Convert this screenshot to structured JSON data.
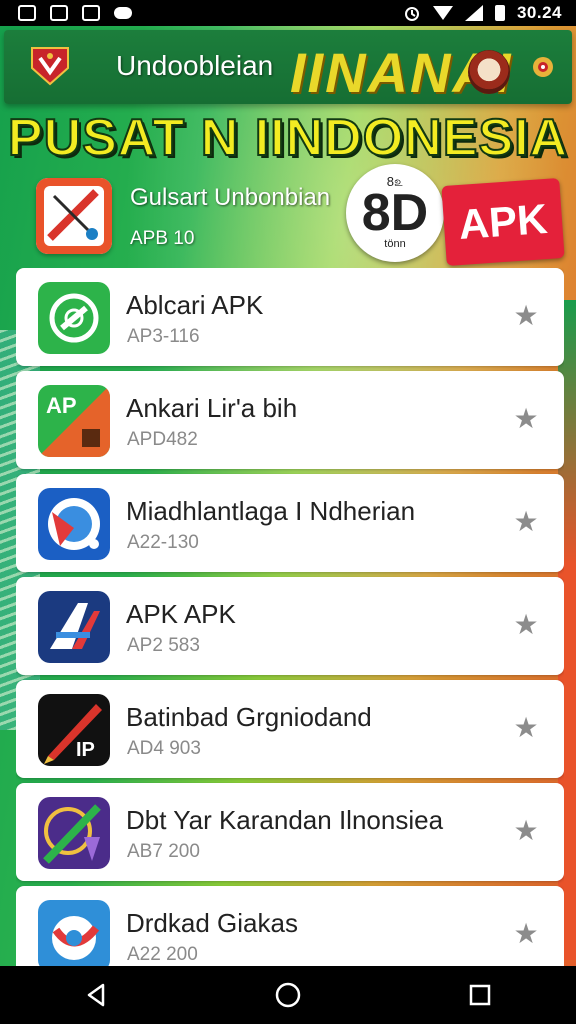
{
  "status_bar": {
    "time": "30.24",
    "left_icons": [
      "image-icon",
      "gallery-icon",
      "photo-icon",
      "cloud-icon"
    ],
    "right_icons": [
      "alarm-icon",
      "wifi-icon",
      "signal-icon",
      "battery-icon"
    ]
  },
  "header": {
    "title": "Undoobleian",
    "brand": "IINANAI",
    "icons": [
      "logo-icon",
      "mascot-icon",
      "gear-icon"
    ]
  },
  "banner": {
    "title": "PUSAT N IINDONESIA"
  },
  "featured": {
    "name": "Gulsart Unbonbian",
    "version": "APB 10",
    "badge_top": "8௨",
    "badge_main": "8D",
    "badge_sub": "tönn",
    "apk_label": "APK"
  },
  "apps": [
    {
      "name": "Ablcari APK",
      "version": "AP3-116",
      "icon": "green-circle-app-icon",
      "color": "#2db34a"
    },
    {
      "name": "Ankari Lir'a bih",
      "version": "APD482",
      "icon": "ap-green-orange-app-icon",
      "color": "#e5632a",
      "label": "AP"
    },
    {
      "name": "Miadhlantlaga I Ndherian",
      "version": "A22-130",
      "icon": "blue-target-app-icon",
      "color": "#1b5fc4"
    },
    {
      "name": "APK APK",
      "version": "AP2 583",
      "icon": "blue-a-app-icon",
      "color": "#1b3a80"
    },
    {
      "name": "Batinbad Grgniodand",
      "version": "AD4 903",
      "icon": "red-pen-app-icon",
      "color": "#d9342b",
      "label": "IP"
    },
    {
      "name": "Dbt Yar Karandan Ilnonsiea",
      "version": "AB7 200",
      "icon": "purple-pen-app-icon",
      "color": "#4b2c8a"
    },
    {
      "name": "Drdkad Giakas",
      "version": "A22 200",
      "icon": "blue-g-app-icon",
      "color": "#2f8fd8"
    }
  ],
  "nav_bar": {
    "buttons": [
      "back-icon",
      "home-icon",
      "recents-icon"
    ]
  }
}
